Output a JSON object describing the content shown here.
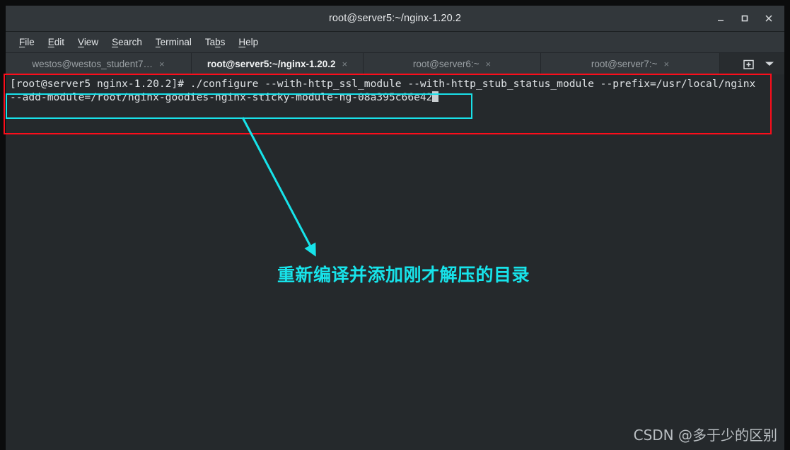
{
  "window": {
    "title": "root@server5:~/nginx-1.20.2",
    "controls": {
      "minimize_label": "Minimize",
      "maximize_label": "Maximize",
      "close_label": "Close"
    }
  },
  "menubar": {
    "items": [
      {
        "pre": "",
        "mnemonic": "F",
        "post": "ile",
        "name": "menu-file"
      },
      {
        "pre": "",
        "mnemonic": "E",
        "post": "dit",
        "name": "menu-edit"
      },
      {
        "pre": "",
        "mnemonic": "V",
        "post": "iew",
        "name": "menu-view"
      },
      {
        "pre": "",
        "mnemonic": "S",
        "post": "earch",
        "name": "menu-search"
      },
      {
        "pre": "",
        "mnemonic": "T",
        "post": "erminal",
        "name": "menu-terminal"
      },
      {
        "pre": "Ta",
        "mnemonic": "b",
        "post": "s",
        "name": "menu-tabs"
      },
      {
        "pre": "",
        "mnemonic": "H",
        "post": "elp",
        "name": "menu-help"
      }
    ]
  },
  "tabs": {
    "items": [
      {
        "label": "westos@westos_student7…",
        "close": "×",
        "active": false
      },
      {
        "label": "root@server5:~/nginx-1.20.2",
        "close": "×",
        "active": true
      },
      {
        "label": "root@server6:~",
        "close": "×",
        "active": false
      },
      {
        "label": "root@server7:~",
        "close": "×",
        "active": false
      }
    ],
    "new_tab_icon": "new-tab-icon",
    "tab_menu_icon": "chevron-down-icon"
  },
  "terminal": {
    "line1": "[root@server5 nginx-1.20.2]# ./configure --with-http_ssl_module --with-http_stub_status_module --prefix=/usr/local/nginx",
    "line2": "--add-module=/root/nginx-goodies-nginx-sticky-module-ng-08a395c66e42",
    "cursor": "block-cursor"
  },
  "annotations": {
    "note_text": "重新编译并添加刚才解压的目录",
    "arrow": "arrow-pointing-down-right",
    "red_highlight": "red-rectangle-highlight",
    "cyan_highlight": "cyan-rectangle-highlight",
    "colors": {
      "red": "#fc0d1b",
      "cyan": "#17e3ea",
      "tab_accent": "#2a6bb5",
      "terminal_bg": "#25292c"
    }
  },
  "watermark": {
    "text": "CSDN @多于少的区别"
  }
}
